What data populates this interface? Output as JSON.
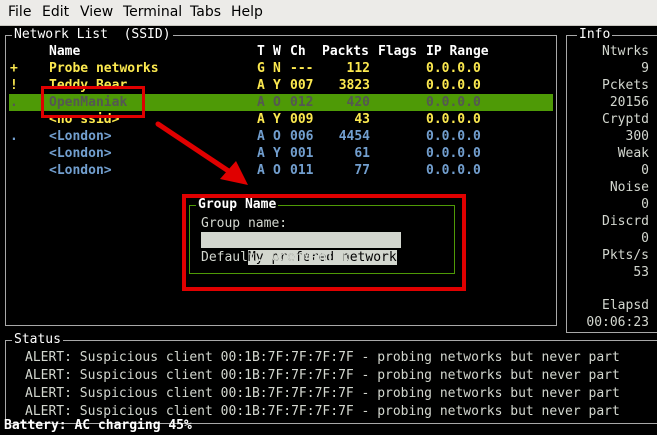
{
  "menu": [
    "File",
    "Edit",
    "View",
    "Terminal",
    "Tabs",
    "Help"
  ],
  "network_list": {
    "title": "Network List  (SSID)",
    "headers": {
      "name": "Name",
      "t": "T",
      "w": "W",
      "ch": "Ch",
      "packets": "Packts",
      "flags": "Flags",
      "ip": "IP Range"
    },
    "rows": [
      {
        "flag": "+",
        "name": "Probe networks",
        "t": "G",
        "w": "N",
        "ch": "---",
        "packets": "112",
        "ip": "0.0.0.0",
        "color": "#fce94f"
      },
      {
        "flag": "!",
        "name": "Teddy Bear",
        "t": "A",
        "w": "Y",
        "ch": "007",
        "packets": "3823",
        "ip": "0.0.0.0",
        "color": "#fce94f"
      },
      {
        "flag": ".",
        "name": "OpenManiak",
        "t": "A",
        "w": "O",
        "ch": "012",
        "packets": "420",
        "ip": "0.0.0.0",
        "color": "#555753",
        "selected": true
      },
      {
        "flag": "",
        "name": "<no ssid>",
        "t": "A",
        "w": "Y",
        "ch": "009",
        "packets": "43",
        "ip": "0.0.0.0",
        "color": "#fce94f"
      },
      {
        "flag": ".",
        "name": "<London>",
        "t": "A",
        "w": "O",
        "ch": "006",
        "packets": "4454",
        "ip": "0.0.0.0",
        "color": "#729fcf"
      },
      {
        "flag": "",
        "name": "<London>",
        "t": "A",
        "w": "Y",
        "ch": "001",
        "packets": "61",
        "ip": "0.0.0.0",
        "color": "#729fcf"
      },
      {
        "flag": "",
        "name": "<London>",
        "t": "A",
        "w": "O",
        "ch": "011",
        "packets": "77",
        "ip": "0.0.0.0",
        "color": "#729fcf"
      }
    ]
  },
  "info": {
    "title": "Info",
    "items": [
      {
        "label": "Ntwrks",
        "value": "9"
      },
      {
        "label": "Pckets",
        "value": "20156"
      },
      {
        "label": "Cryptd",
        "value": "300"
      },
      {
        "label": "Weak",
        "value": "0"
      },
      {
        "label": "Noise",
        "value": "0"
      },
      {
        "label": "Discrd",
        "value": "0"
      },
      {
        "label": "Pkts/s",
        "value": "53"
      }
    ],
    "elapsed_label": "Elapsd",
    "elapsed_value": "00:06:23"
  },
  "dialog": {
    "title": "Group Name",
    "prompt": "Group name:",
    "input_value": "My prefered network",
    "default_text": "Default: OpenManiak"
  },
  "status": {
    "title": "Status",
    "lines": [
      "ALERT: Suspicious client 00:1B:7F:7F:7F:7F - probing networks but never part",
      "ALERT: Suspicious client 00:1B:7F:7F:7F:7F - probing networks but never part",
      "ALERT: Suspicious client 00:1B:7F:7F:7F:7F - probing networks but never part",
      "ALERT: Suspicious client 00:1B:7F:7F:7F:7F - probing networks but never part"
    ],
    "battery": "Battery: AC charging 45%"
  },
  "colors": {
    "annotation": "#e00000",
    "selection": "#4e9a06"
  }
}
